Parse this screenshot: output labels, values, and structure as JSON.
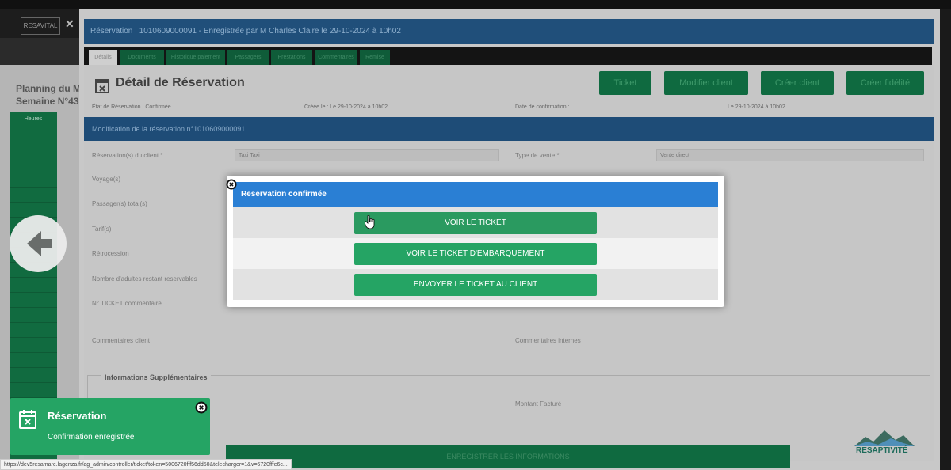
{
  "app": {
    "logo_text": "RESAVITAL",
    "left_planning_line1": "Planning du Mardi",
    "left_planning_line2": "Semaine N°43",
    "planning_rows": [
      "Heures",
      "",
      "",
      "",
      "",
      "",
      "",
      "",
      "",
      "",
      "",
      "",
      "",
      "",
      "",
      "",
      "",
      "",
      "",
      "",
      "",
      ""
    ]
  },
  "reservation_banner": "Réservation : 1010609000091 - Enregistrée par M Charles Claire le 29-10-2024 à 10h02",
  "tabs": [
    "Détails",
    "Documents",
    "Historique paiement",
    "Passagers",
    "Prestations",
    "Commentaires",
    "Remise"
  ],
  "detail": {
    "title": "Détail de Réservation",
    "actions": [
      "Ticket",
      "Modifier client",
      "Créer client",
      "Créer fidélité"
    ],
    "info_row": [
      "État de Réservation : Confirmée",
      "Créée le : Le 29-10-2024 à 10h02",
      "Date de confirmation :",
      "Le 29-10-2024 à 10h02"
    ],
    "modification_banner": "Modification de la réservation n°1010609000091",
    "labels": [
      "Réservation(s) du client *",
      "Voyage(s)",
      "Passager(s) total(s)",
      "Tarif(s)",
      "Rétrocession",
      "Nombre d'adultes restant reservables",
      "N° TICKET commentaire",
      "Commentaires client"
    ],
    "field_client": "Taxi Taxi",
    "field_type_label": "Type de vente *",
    "field_type_value": "Vente direct",
    "comment_interne_label": "Commentaires internes",
    "info_supp_title": "Informations Supplémentaires",
    "montant_label": "Montant Facturé",
    "save_button": "ENREGISTRER LES INFORMATIONS"
  },
  "modal": {
    "title": "Reservation confirmée",
    "buttons": [
      "VOIR LE TICKET",
      "VOIR LE TICKET D'EMBARQUEMENT",
      "ENVOYER LE TICKET AU CLIENT"
    ]
  },
  "toast": {
    "title": "Réservation",
    "message": "Confirmation enregistrée"
  },
  "status_url": "https://dev5resamare.lagenza.fr/ag_admin/controller/ticket/token=5006720fff56dd50&telecharger=1&v=6720fffe6c...",
  "brand_logo_text": "RESAPTIVITÉ",
  "colors": {
    "accent_green": "#25a464",
    "header_blue": "#2a7fd4"
  }
}
